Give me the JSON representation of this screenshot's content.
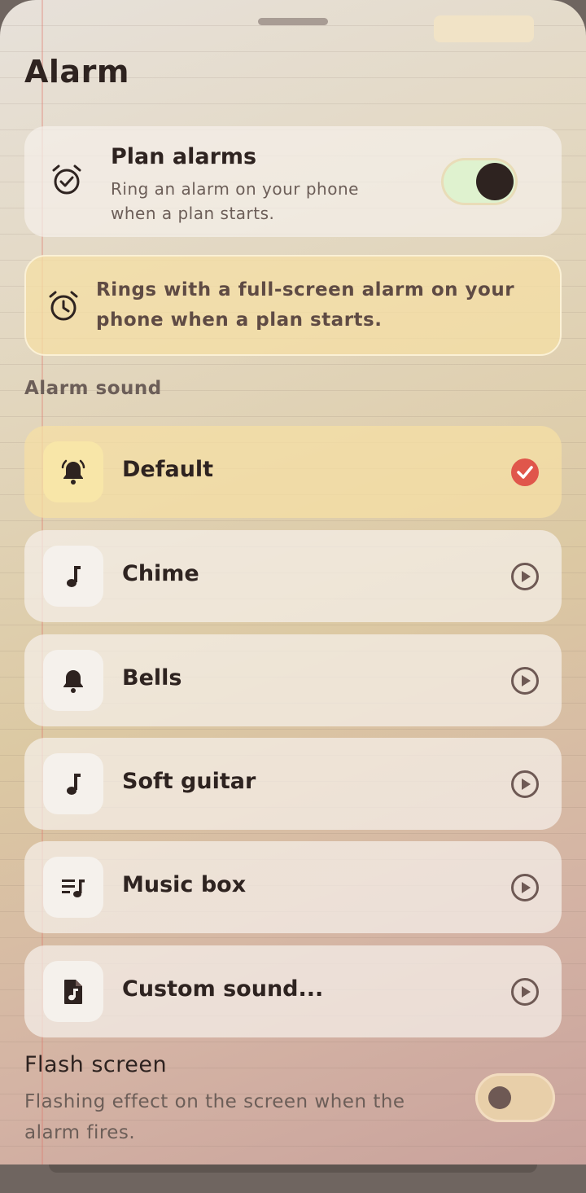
{
  "header": {
    "title": "Alarm"
  },
  "plan_alarms": {
    "title": "Plan alarms",
    "description": "Ring an alarm on your phone when a plan starts.",
    "enabled": true
  },
  "info": {
    "text": "Rings with a full-screen alarm on your phone when a plan starts."
  },
  "sounds": {
    "section_label": "Alarm sound",
    "items": [
      {
        "label": "Default",
        "icon": "bell-ringing-icon",
        "selected": true
      },
      {
        "label": "Chime",
        "icon": "music-note-icon",
        "selected": false
      },
      {
        "label": "Bells",
        "icon": "bell-icon",
        "selected": false
      },
      {
        "label": "Soft guitar",
        "icon": "music-note-icon",
        "selected": false
      },
      {
        "label": "Music box",
        "icon": "music-list-icon",
        "selected": false
      },
      {
        "label": "Custom sound...",
        "icon": "audio-file-icon",
        "selected": false
      }
    ]
  },
  "flash": {
    "title": "Flash screen",
    "description": "Flashing effect on the screen when the alarm fires.",
    "enabled": false
  },
  "colors": {
    "accent": "#e0564b",
    "toggle_on": "#dff2cf",
    "toggle_off": "#e8cfa9",
    "text": "#2e2320",
    "info_bg": "#f5dfa4"
  }
}
